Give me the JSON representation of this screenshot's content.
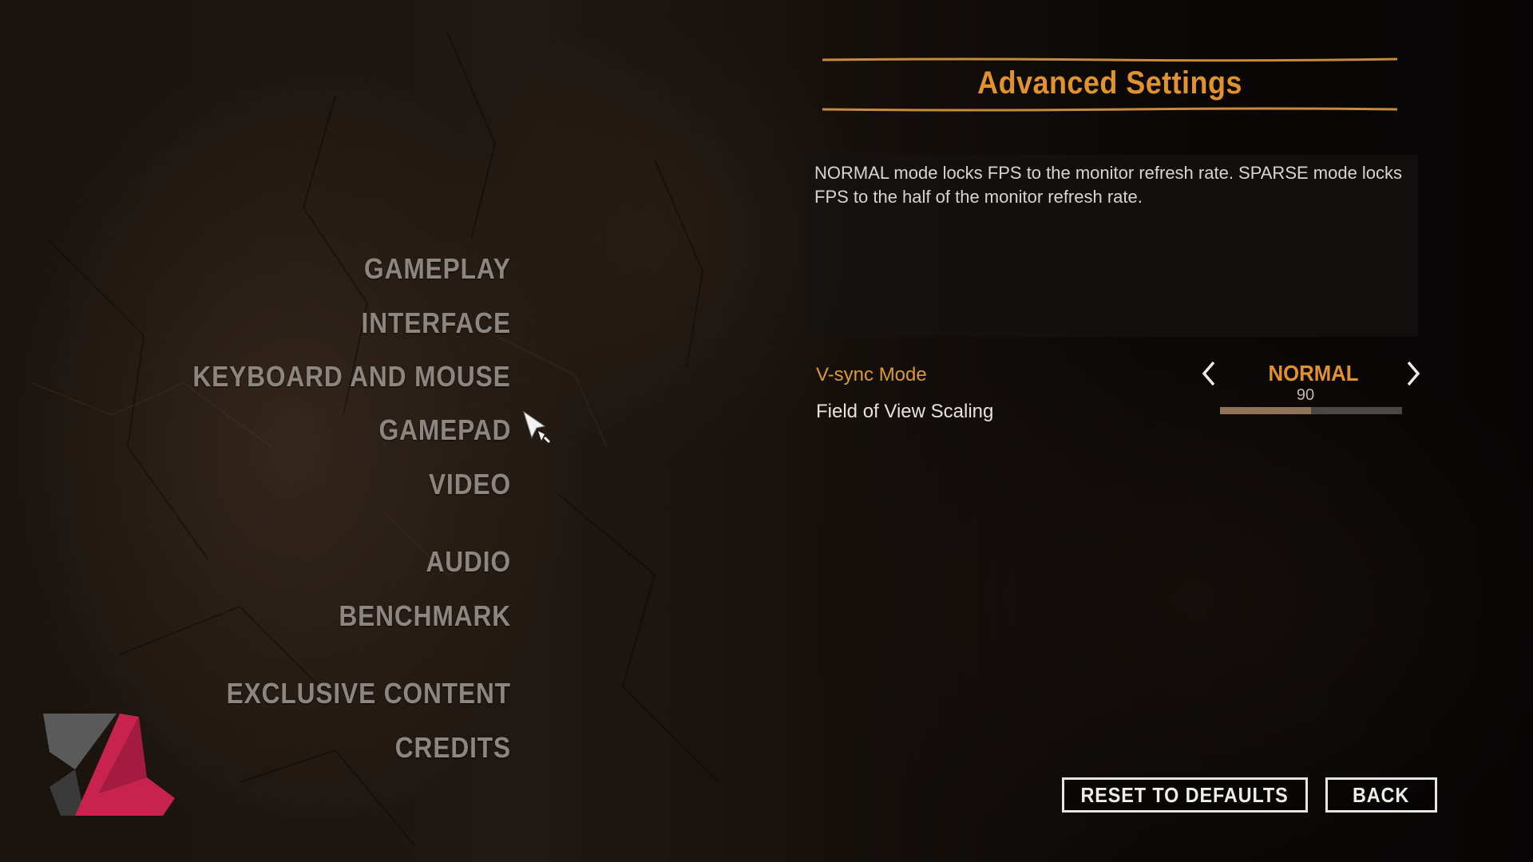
{
  "menu": {
    "items": [
      {
        "label": "GAMEPLAY"
      },
      {
        "label": "INTERFACE"
      },
      {
        "label": "KEYBOARD AND MOUSE"
      },
      {
        "label": "GAMEPAD"
      },
      {
        "label": "VIDEO"
      },
      {
        "label": "AUDIO"
      },
      {
        "label": "BENCHMARK"
      },
      {
        "label": "EXCLUSIVE CONTENT"
      },
      {
        "label": "CREDITS"
      }
    ]
  },
  "panel": {
    "title": "Advanced Settings",
    "description": "NORMAL mode locks FPS to the monitor refresh rate. SPARSE mode locks FPS to the half of the monitor refresh rate.",
    "settings": {
      "vsync": {
        "label": "V-sync Mode",
        "value": "NORMAL"
      },
      "fov": {
        "label": "Field of View Scaling",
        "value": "90",
        "fill_fraction": 0.5
      }
    }
  },
  "buttons": {
    "reset": "RESET TO DEFAULTS",
    "back": "BACK"
  },
  "colors": {
    "accent": "#e0922f",
    "menu_text": "#8c8580",
    "logo_red": "#c8234e",
    "logo_grey": "#5a5a5a"
  },
  "icons": {
    "left": "chevron-left-icon",
    "right": "chevron-right-icon",
    "cursor": "mouse-pointer-icon",
    "logo": "brand-logo"
  }
}
